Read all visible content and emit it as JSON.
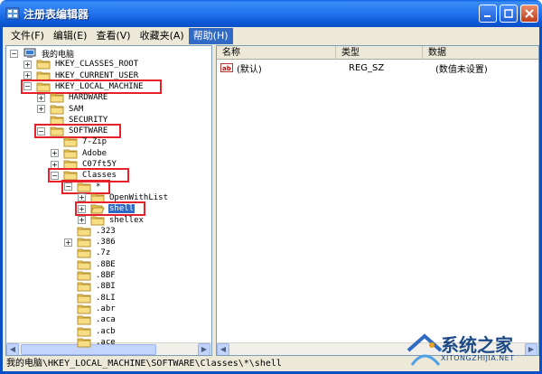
{
  "window": {
    "title": "注册表编辑器"
  },
  "menu": [
    {
      "label": "文件(F)",
      "active": false
    },
    {
      "label": "编辑(E)",
      "active": false
    },
    {
      "label": "查看(V)",
      "active": false
    },
    {
      "label": "收藏夹(A)",
      "active": false
    },
    {
      "label": "帮助(H)",
      "active": true
    }
  ],
  "tree": [
    {
      "label": "我的电脑",
      "expander": "−",
      "icon": "computer-icon"
    },
    {
      "label": "HKEY_CLASSES_ROOT",
      "expander": "+",
      "icon": "folder-icon"
    },
    {
      "label": "HKEY_CURRENT_USER",
      "expander": "+",
      "icon": "folder-icon"
    },
    {
      "label": "HKEY_LOCAL_MACHINE",
      "expander": "−",
      "icon": "folder-icon",
      "highlight": true
    },
    {
      "label": "HARDWARE",
      "expander": "+",
      "icon": "folder-icon"
    },
    {
      "label": "SAM",
      "expander": "+",
      "icon": "folder-icon"
    },
    {
      "label": "SECURITY",
      "expander": "",
      "icon": "folder-icon"
    },
    {
      "label": "SOFTWARE",
      "expander": "−",
      "icon": "folder-icon",
      "highlight": true
    },
    {
      "label": "7-Zip",
      "expander": "",
      "icon": "folder-icon"
    },
    {
      "label": "Adobe",
      "expander": "+",
      "icon": "folder-icon"
    },
    {
      "label": "C07ft5Y",
      "expander": "+",
      "icon": "folder-icon"
    },
    {
      "label": "Classes",
      "expander": "−",
      "icon": "folder-icon",
      "highlight": true
    },
    {
      "label": "*",
      "expander": "−",
      "icon": "folder-icon",
      "highlight": true
    },
    {
      "label": "OpenWithList",
      "expander": "+",
      "icon": "folder-icon"
    },
    {
      "label": "shell",
      "expander": "+",
      "icon": "folder-open-icon",
      "selected": true,
      "highlight": true
    },
    {
      "label": "shellex",
      "expander": "+",
      "icon": "folder-icon"
    },
    {
      "label": ".323",
      "expander": "",
      "icon": "folder-icon"
    },
    {
      "label": ".386",
      "expander": "+",
      "icon": "folder-icon"
    },
    {
      "label": ".7z",
      "expander": "",
      "icon": "folder-icon"
    },
    {
      "label": ".8BE",
      "expander": "",
      "icon": "folder-icon"
    },
    {
      "label": ".8BF",
      "expander": "",
      "icon": "folder-icon"
    },
    {
      "label": ".8BI",
      "expander": "",
      "icon": "folder-icon"
    },
    {
      "label": ".8LI",
      "expander": "",
      "icon": "folder-icon"
    },
    {
      "label": ".abr",
      "expander": "",
      "icon": "folder-icon"
    },
    {
      "label": ".aca",
      "expander": "",
      "icon": "folder-icon"
    },
    {
      "label": ".acb",
      "expander": "",
      "icon": "folder-icon"
    },
    {
      "label": ".ace",
      "expander": "",
      "icon": "folder-icon"
    }
  ],
  "list": {
    "columns": [
      "名称",
      "类型",
      "数据"
    ],
    "rows": [
      {
        "icon": "ab-value-icon",
        "name": "(默认)",
        "type": "REG_SZ",
        "data": "(数值未设置)"
      }
    ]
  },
  "status": {
    "path": "我的电脑\\HKEY_LOCAL_MACHINE\\SOFTWARE\\Classes\\*\\shell"
  },
  "watermark": {
    "text": "系统之家",
    "url": "XITONGZHIJIA.NET"
  },
  "colors": {
    "highlight_box": "#e8202a",
    "selection": "#316ac5",
    "titlebar": "#2576ef"
  }
}
